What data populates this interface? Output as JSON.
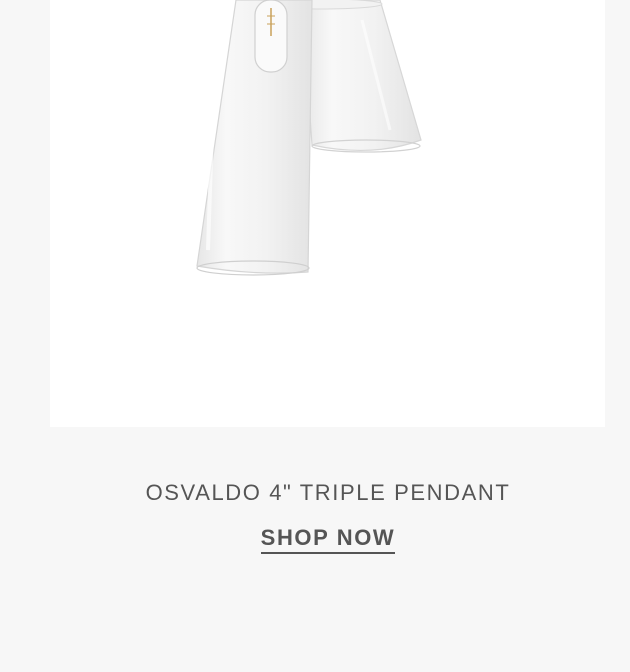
{
  "product": {
    "title": "OSVALDO 4\" TRIPLE PENDANT",
    "image_alt": "Osvaldo triple pendant with clear glass cone shades"
  },
  "cta": {
    "label": "SHOP NOW"
  },
  "colors": {
    "page_background": "#f7f7f7",
    "card_background": "#ffffff",
    "text": "#555555"
  }
}
